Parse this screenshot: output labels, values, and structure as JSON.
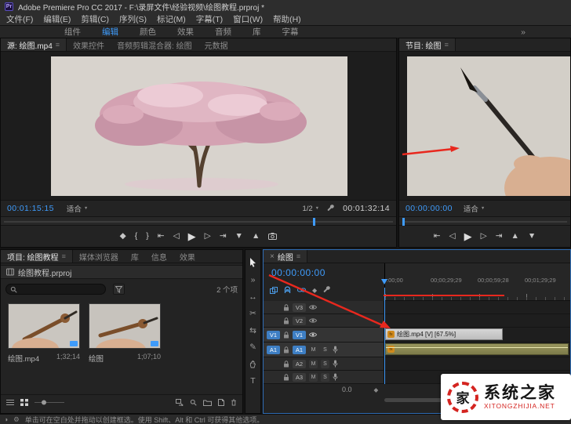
{
  "titlebar": {
    "app_icon": "Pr",
    "title": "Adobe Premiere Pro CC 2017 - F:\\录屏文件\\经验视频\\绘图教程.prproj *"
  },
  "menubar": {
    "items": [
      "文件(F)",
      "编辑(E)",
      "剪辑(C)",
      "序列(S)",
      "标记(M)",
      "字幕(T)",
      "窗口(W)",
      "帮助(H)"
    ]
  },
  "workspace": {
    "items": [
      "组件",
      "编辑",
      "颜色",
      "效果",
      "音频",
      "库",
      "字幕"
    ],
    "overflow": "»"
  },
  "source": {
    "tabs": [
      "源: 绘图.mp4",
      "效果控件",
      "音频剪辑混合器: 绘图",
      "元数据"
    ],
    "timecode": "00:01:15:15",
    "zoom_select": "适合",
    "res_select": "1/2",
    "duration": "00:01:32:14"
  },
  "program": {
    "tab": "节目: 绘图",
    "timecode": "00:00:00:00",
    "zoom_select": "适合"
  },
  "project": {
    "tabs": [
      "项目: 绘图教程",
      "媒体浏览器",
      "库",
      "信息",
      "效果"
    ],
    "file_row": "绘图教程.prproj",
    "count": "2 个项",
    "items": [
      {
        "name": "绘图.mp4",
        "duration": "1;32;14"
      },
      {
        "name": "绘图",
        "duration": "1;07;10"
      }
    ]
  },
  "timeline": {
    "tab": "绘图",
    "timecode": "00:00:00:00",
    "ruler": [
      ":00;00",
      "00;00;29;29",
      "00;00;59;28",
      "00;01;29;29"
    ],
    "tracks": {
      "video": [
        {
          "badge": "V3",
          "src": ""
        },
        {
          "badge": "V2",
          "src": ""
        },
        {
          "badge": "V1",
          "src": "V1"
        }
      ],
      "audio": [
        {
          "badge": "A1",
          "src": "A1"
        },
        {
          "badge": "A2",
          "src": ""
        },
        {
          "badge": "A3",
          "src": ""
        }
      ]
    },
    "mute": "M",
    "solo": "S",
    "clip_label": "绘图.mp4 [V] [67.5%]",
    "clip_fx": "fx",
    "gain": "0.0"
  },
  "statusbar": {
    "hint": "单击可在空白处并拖动以创建框选。使用 Shift、Alt 和 Ctrl 可获得其他选项。"
  },
  "watermark": {
    "logo_char": "家",
    "name": "系统之家",
    "site": "XITONGZHIJIA.NET"
  },
  "icons": {
    "hamburger": "≡",
    "caret": "▼",
    "close": "×",
    "add_marker": "◆",
    "mark_in": "{",
    "mark_out": "}",
    "goto_in": "⇤",
    "step_back": "◁",
    "play": "▶",
    "step_fwd": "▷",
    "goto_out": "⇥",
    "lift": "▲",
    "extract": "▼",
    "track_select": "»",
    "ripple": "↔",
    "razor": "✂",
    "slip": "⇆",
    "pen": "✎",
    "type": "T",
    "marker_small": "◆",
    "keyframe": "◆",
    "gear": "⚙",
    "half": "◑"
  },
  "colors": {
    "accent_blue": "#3f9bfa",
    "annotation_red": "#e8281e"
  }
}
